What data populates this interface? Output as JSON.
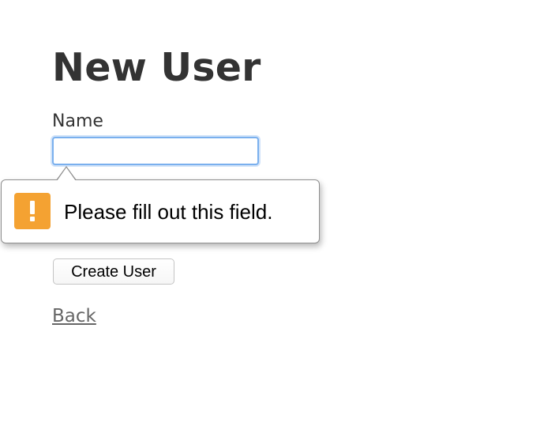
{
  "page": {
    "title": "New User"
  },
  "form": {
    "name_label": "Name",
    "name_value": "",
    "submit_label": "Create User"
  },
  "validation": {
    "message": "Please fill out this field.",
    "icon": "warning-icon",
    "icon_color": "#f4a232"
  },
  "nav": {
    "back_label": "Back"
  },
  "colors": {
    "text": "#333333",
    "focus_ring": "#7ab0ee",
    "link": "#666666"
  }
}
